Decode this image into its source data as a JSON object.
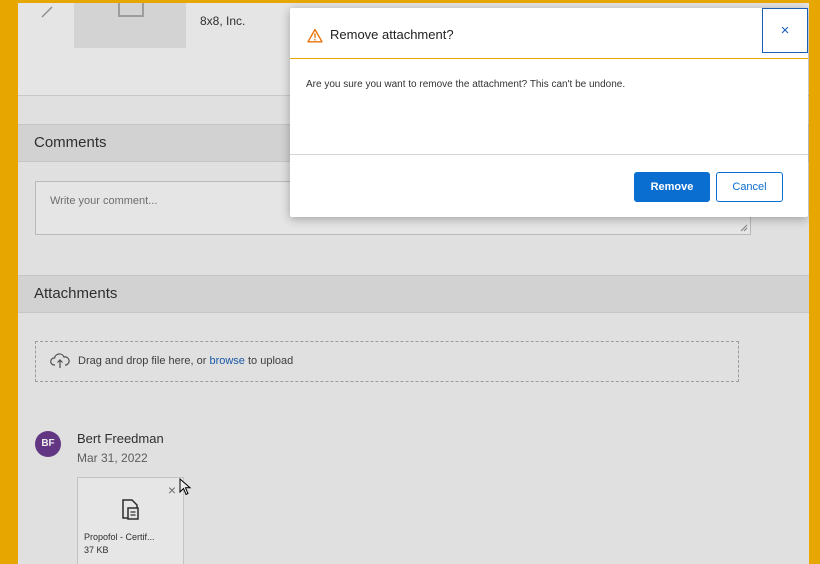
{
  "item": {
    "company": "8x8, Inc."
  },
  "comments": {
    "title": "Comments",
    "placeholder": "Write your comment..."
  },
  "attachments": {
    "title": "Attachments",
    "upload_text_before": "Drag and drop file here, or ",
    "upload_link": "browse",
    "upload_text_after": " to upload"
  },
  "entry": {
    "initials": "BF",
    "name": "Bert Freedman",
    "date": "Mar 31, 2022",
    "file": {
      "name": "Propofol - Certif...",
      "size": "37 KB",
      "close": "×"
    }
  },
  "dialog": {
    "title": "Remove attachment?",
    "close": "×",
    "message": "Are you sure you want to remove the attachment? This can't be undone.",
    "remove_label": "Remove",
    "cancel_label": "Cancel"
  },
  "colors": {
    "accent": "#0a6ed1",
    "warning": "#e8a600",
    "avatar": "#6b3b8d"
  }
}
